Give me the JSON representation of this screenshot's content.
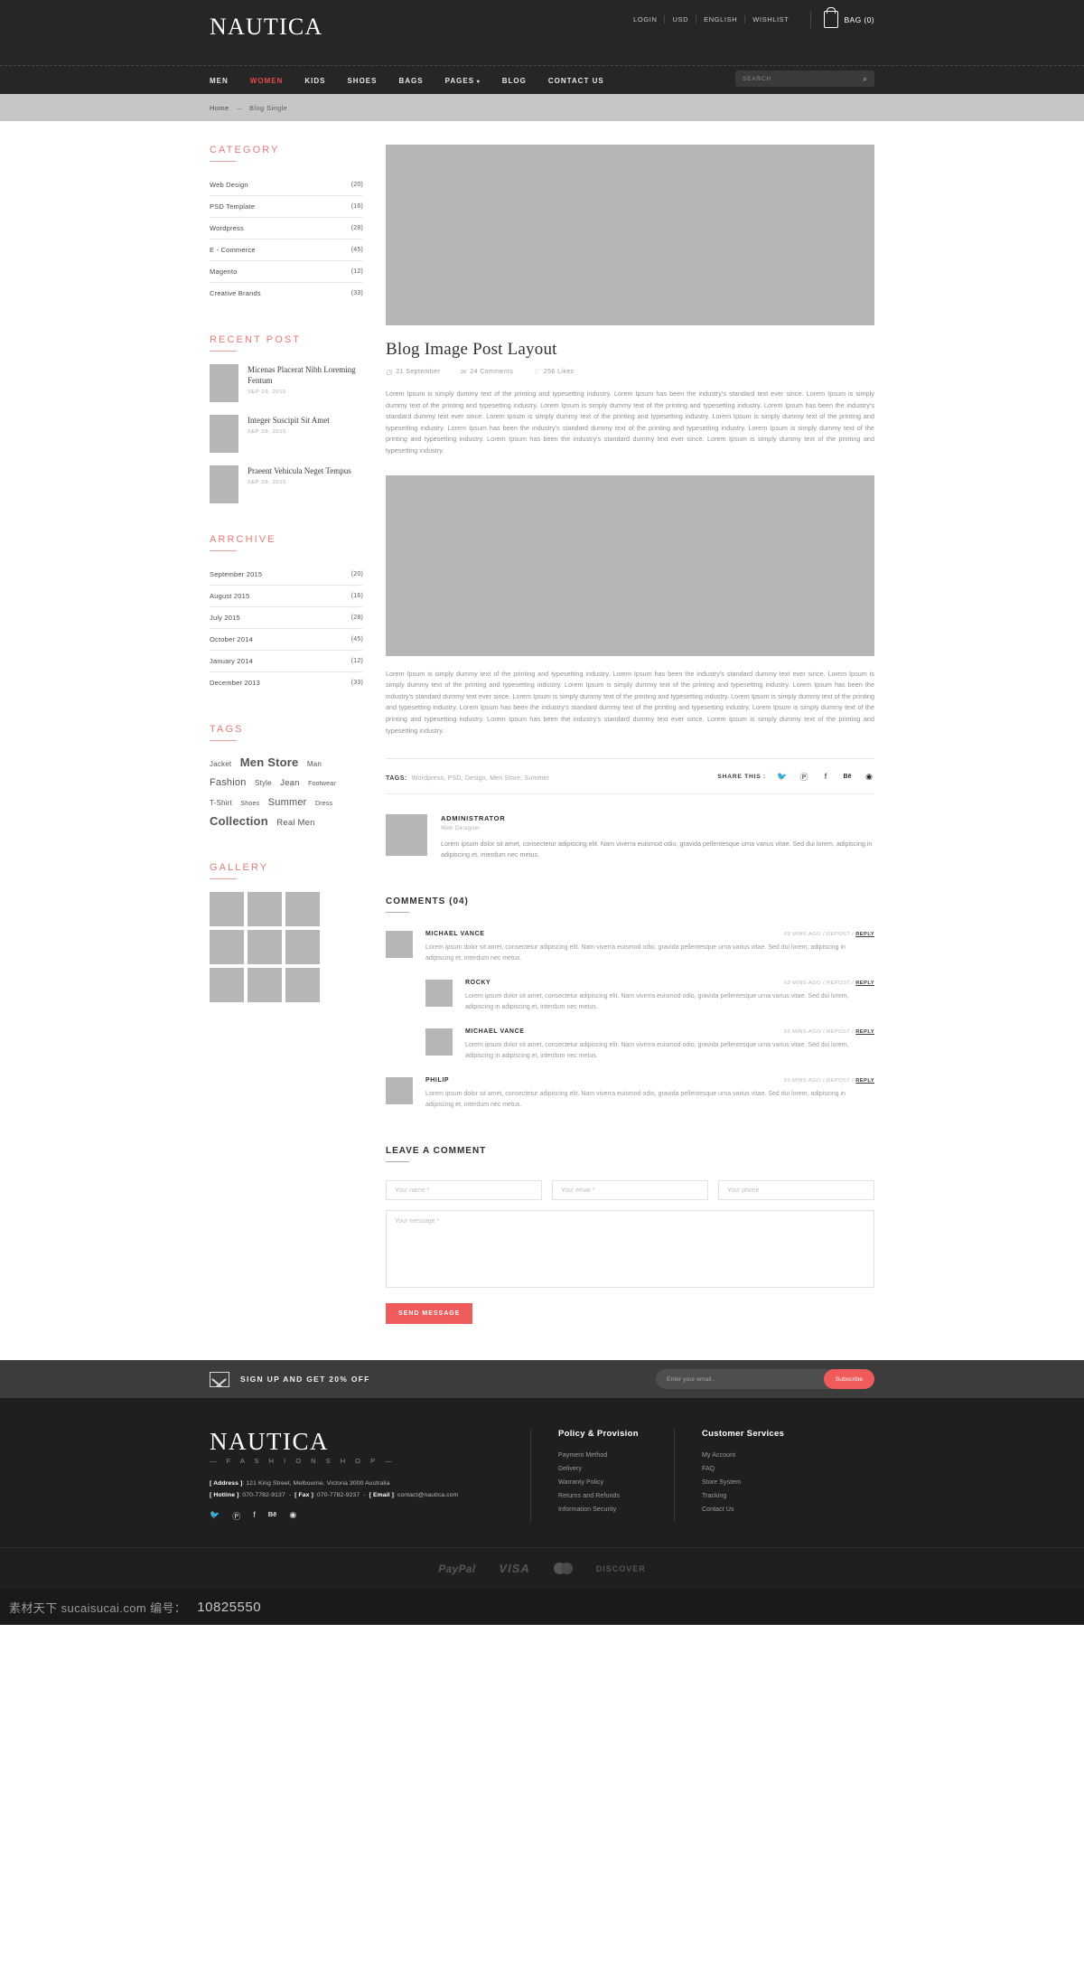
{
  "header": {
    "brand": "NAUTICA",
    "utility": [
      {
        "label": "LOGIN"
      },
      {
        "label": "USD"
      },
      {
        "label": "ENGLISH"
      },
      {
        "label": "WISHLIST"
      }
    ],
    "bag_label": "BAG (0)",
    "nav": [
      {
        "label": "MEN",
        "active": false
      },
      {
        "label": "WOMEN",
        "active": true
      },
      {
        "label": "KIDS",
        "active": false
      },
      {
        "label": "SHOES",
        "active": false
      },
      {
        "label": "BAGS",
        "active": false
      },
      {
        "label": "PAGES",
        "active": false,
        "dropdown": true
      },
      {
        "label": "BLOG",
        "active": false
      },
      {
        "label": "CONTACT US",
        "active": false
      }
    ],
    "search_placeholder": "SEARCH"
  },
  "breadcrumb": {
    "home": "Home",
    "arrow": "→",
    "current": "Blog Single"
  },
  "sidebar": {
    "category": {
      "title": "CATEGORY",
      "items": [
        {
          "label": "Web Design",
          "count": "(20)"
        },
        {
          "label": "PSD Template",
          "count": "(16)"
        },
        {
          "label": "Wordpress",
          "count": "(28)"
        },
        {
          "label": "E - Commerce",
          "count": "(45)"
        },
        {
          "label": "Magento",
          "count": "(12)"
        },
        {
          "label": "Creative Brands",
          "count": "(33)"
        }
      ]
    },
    "recent_post": {
      "title": "RECENT POST",
      "items": [
        {
          "title": "Micenas Placerat Nibh Loreming Fentum",
          "date": "SEP 29, 2015"
        },
        {
          "title": "Integer Suscipit Sit Amet",
          "date": "SEP 29, 2015"
        },
        {
          "title": "Praeent Vehicula Neget Tempus",
          "date": "SEP 29, 2015"
        }
      ]
    },
    "archive": {
      "title": "ARRCHIVE",
      "items": [
        {
          "label": "September 2015",
          "count": "(20)"
        },
        {
          "label": "August 2015",
          "count": "(16)"
        },
        {
          "label": "July 2015",
          "count": "(28)"
        },
        {
          "label": "October 2014",
          "count": "(45)"
        },
        {
          "label": "January 2014",
          "count": "(12)"
        },
        {
          "label": "December 2013",
          "count": "(33)"
        }
      ]
    },
    "tags": {
      "title": "TAGS",
      "items": [
        {
          "label": "Jacket",
          "size": "t-s"
        },
        {
          "label": "Men Store",
          "size": "t-xl"
        },
        {
          "label": "Man",
          "size": "t-s"
        },
        {
          "label": "Fashion",
          "size": "t-l"
        },
        {
          "label": "Style",
          "size": "t-s"
        },
        {
          "label": "Jean",
          "size": "t-m"
        },
        {
          "label": "Footwear",
          "size": "t-xs"
        },
        {
          "label": "T-Shirt",
          "size": "t-s"
        },
        {
          "label": "Shoes",
          "size": "t-xs"
        },
        {
          "label": "Summer",
          "size": "t-l"
        },
        {
          "label": "Dress",
          "size": "t-xs"
        },
        {
          "label": "Collection",
          "size": "t-xl"
        },
        {
          "label": "Real Men",
          "size": "t-m"
        }
      ]
    },
    "gallery": {
      "title": "GALLERY",
      "count": 9
    }
  },
  "post": {
    "title": "Blog Image Post Layout",
    "meta": {
      "date": "21 September",
      "comments": "24 Comments",
      "likes": "256 Likes"
    },
    "paragraph1": "Lorem Ipsum is simply dummy text of the printing and typesetting industry. Lorem Ipsum has been the industry's standard text ever since. Lorem Ipsum is simply dummy text of the printing and typesetting industry. Lorem Ipsum is simply dummy text of the printing and typesetting industry. Lorem Ipsum has been the industry's standard dummy text ever since. Lorem Ipsum is simply dummy text of the printing and typesetting industry. Lorem Ipsum is simply dummy text of the printing and typesetting industry. Lorem Ipsum has been the industry's standard dummy text of the printing and typesetting industry. Lorem Ipsum is simply dummy text of the printing and typesetting industry. Lorem Ipsum has been the industry's standard dummy text ever since. Lorem Ipsum is simply dummy text of the printing and typesetting industry.",
    "paragraph2": "Lorem Ipsum is simply dummy text of the printing and typesetting industry. Lorem Ipsum has been the industry's standard dummy text ever since. Lorem Ipsum is simply dummy text of the printing and typesetting industry. Lorem Ipsum is simply dummy text of the printing and typesetting industry. Lorem Ipsum has been the industry's standard dummy text ever since. Lorem Ipsum is simply dummy text of the printing and typesetting industry. Lorem Ipsum is simply dummy text of the printing and typesetting industry. Lorem Ipsum has been the industry's standard dummy text of the printing and typesetting industry. Lorem Ipsum is simply dummy text of the printing and typesetting industry. Lorem Ipsum has been the industry's standard dummy text ever since. Lorem Ipsum is simply dummy text of the printing and typesetting industry.",
    "tags_label": "TAGS:",
    "tags_value": "Wordpress, PSD, Design, Men Store, Summer",
    "share_label": "SHARE THIS :",
    "share_icons": [
      "twitter-icon",
      "pinterest-icon",
      "facebook-icon",
      "behance-icon",
      "dribbble-icon"
    ]
  },
  "author": {
    "name": "ADMINISTRATOR",
    "role": "Web Designer",
    "bio": "Lorem ipsum dolor sit amet, consectetur adipiscing elit. Nam viverra euismod odio, gravida pellentesque urna varius vitae. Sed dui lorem, adipiscing in adipiscing et, interdum nec metus."
  },
  "comments": {
    "heading": "COMMENTS (04)",
    "items": [
      {
        "name": "MICHAEL VANCE",
        "time": "03 MINS AGO",
        "repost": "REPOST",
        "reply": "REPLY",
        "text": "Lorem ipsum dolor sit amet, consectetur adipiscing elit. Nam viverra euismod odio, gravida pellentesque urna varius vitae. Sed dui lorem, adipiscing in adipiscing et, interdum nec metus.",
        "level": 1
      },
      {
        "name": "ROCKY",
        "time": "03 MINS AGO",
        "repost": "REPOST",
        "reply": "REPLY",
        "text": "Lorem ipsum dolor sit amet, consectetur adipiscing elit. Nam viverra euismod odio, gravida pellentesque urna varius vitae. Sed dui lorem, adipiscing in adipiscing et, interdum nec metus.",
        "level": 2
      },
      {
        "name": "MICHAEL VANCE",
        "time": "03 MINS AGO",
        "repost": "REPOST",
        "reply": "REPLY",
        "text": "Lorem ipsum dolor sit amet, consectetur adipiscing elit. Nam viverra euismod odio, gravida pellentesque urna varius vitae. Sed dui lorem, adipiscing in adipiscing et, interdum nec metus.",
        "level": 2
      },
      {
        "name": "PHILIP",
        "time": "03 MINS AGO",
        "repost": "REPOST",
        "reply": "REPLY",
        "text": "Lorem ipsum dolor sit amet, consectetur adipiscing elit. Nam viverra euismod odio, gravida pellentesque urna varius vitae. Sed dui lorem, adipiscing in adipiscing et, interdum nec metus.",
        "level": 1
      }
    ]
  },
  "comment_form": {
    "heading": "LEAVE A COMMENT",
    "name_placeholder": "Your name *",
    "email_placeholder": "Your email *",
    "phone_placeholder": "Your phone",
    "message_placeholder": "Your message *",
    "submit_label": "SEND MESSAGE",
    "accent": "#ef5a5a"
  },
  "newsletter": {
    "text": "SIGN UP AND GET 20% OFF",
    "placeholder": "Enter your email..",
    "button": "Subscribe"
  },
  "footer": {
    "brand": "NAUTICA",
    "tagline": "— F A S H I O N   S H O P —",
    "address_label": "[ Address ]",
    "address_value": ": 121 King Street, Melbourne,  Victoria 3000 Australia",
    "hotline_label": "[ Hotline ]",
    "hotline_value": ": 070-7782-9137",
    "fax_label": "[ Fax ]",
    "fax_value": ": 070-7782-9237",
    "email_label": "[ Email ]",
    "email_value": ": contact@nautica.com",
    "social": [
      "twitter-icon",
      "pinterest-icon",
      "facebook-icon",
      "behance-icon",
      "dribbble-icon"
    ],
    "columns": [
      {
        "heading": "Policy & Provision",
        "links": [
          "Payment Method",
          "Delivery",
          "Warranty Policy",
          "Returns and Refunds",
          "Information Security"
        ]
      },
      {
        "heading": "Customer Services",
        "links": [
          "My Account",
          "FAQ",
          "Store System",
          "Tracking",
          "Contact Us"
        ]
      }
    ],
    "payments": [
      "PayPal",
      "VISA",
      "mastercard-icon",
      "DISCOVER"
    ]
  },
  "watermark": {
    "site": "素材天下 sucaisucai.com  编号：",
    "number": "10825550"
  }
}
